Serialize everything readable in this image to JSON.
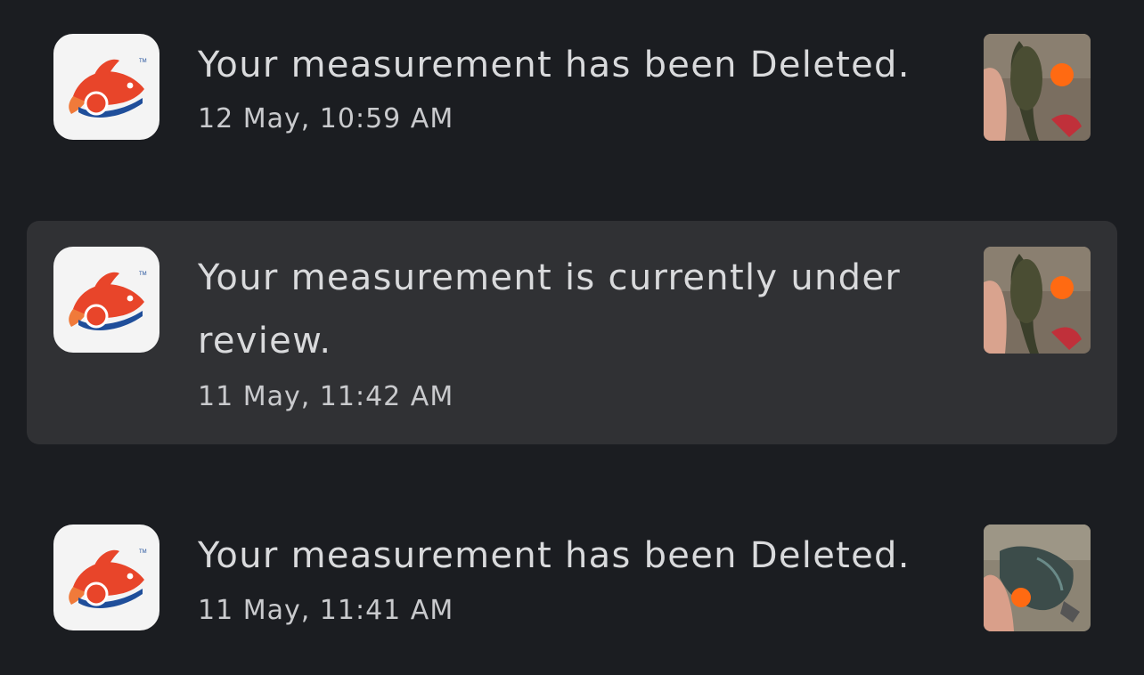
{
  "app": {
    "icon": "fish-measure-logo-icon"
  },
  "notifications": [
    {
      "message": "Your measurement has been Deleted.",
      "time": "12 May, 10:59 AM",
      "thumbnail": "fish-photo-thumbnail",
      "highlighted": false
    },
    {
      "message": "Your measurement is currently under review.",
      "time": "11 May, 11:42 AM",
      "thumbnail": "fish-photo-thumbnail",
      "highlighted": true
    },
    {
      "message": "Your measurement has been Deleted.",
      "time": "11 May, 11:41 AM",
      "thumbnail": "fish-photo-thumbnail",
      "highlighted": false
    }
  ],
  "colors": {
    "background": "#1b1d21",
    "highlight": "#303134",
    "logo_red": "#e8452a",
    "logo_blue": "#1f4e9a"
  }
}
